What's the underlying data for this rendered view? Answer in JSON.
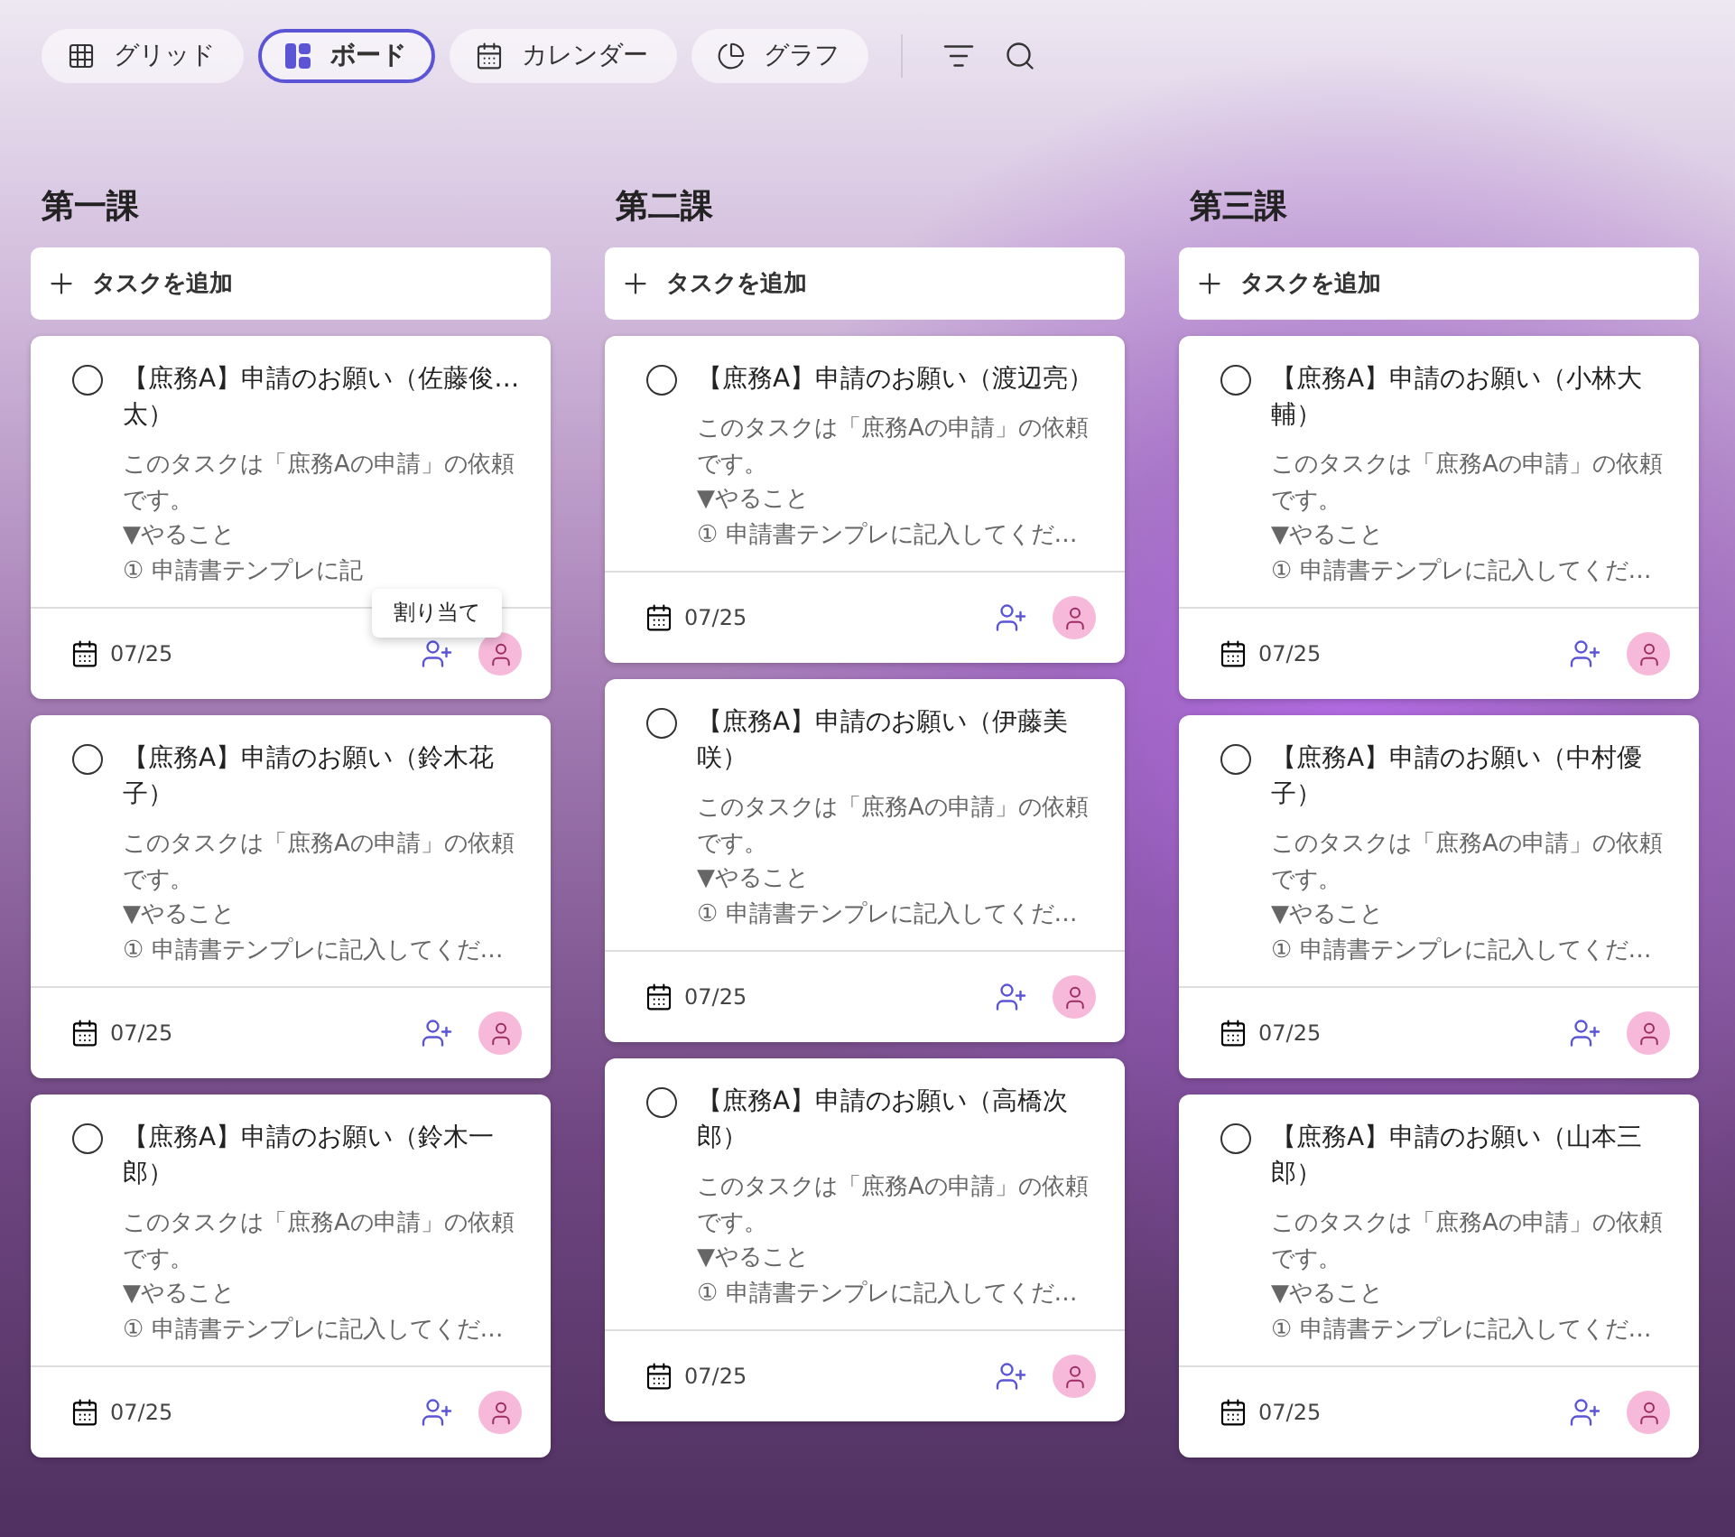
{
  "views": [
    {
      "kind": "grid",
      "label": "グリッド",
      "selected": false
    },
    {
      "kind": "board",
      "label": "ボード",
      "selected": true
    },
    {
      "kind": "calendar",
      "label": "カレンダー",
      "selected": false
    },
    {
      "kind": "chart",
      "label": "グラフ",
      "selected": false
    }
  ],
  "columns": [
    {
      "title": "第一課",
      "add_label": "タスクを追加",
      "cards": [
        {
          "checked": false,
          "title": "【庶務A】申請のお願い（佐藤俊…太）",
          "description": [
            "このタスクは「庶務Aの申請」の依頼です。",
            "▼やること",
            "① 申請書テンプレに記"
          ],
          "due": "07/25",
          "tooltip": "割り当て"
        },
        {
          "checked": false,
          "title": "【庶務A】申請のお願い（鈴木花子）",
          "description": [
            "このタスクは「庶務Aの申請」の依頼です。",
            "▼やること",
            "① 申請書テンプレに記入してくだ…"
          ],
          "due": "07/25"
        },
        {
          "checked": false,
          "title": "【庶務A】申請のお願い（鈴木一郎）",
          "description": [
            "このタスクは「庶務Aの申請」の依頼です。",
            "▼やること",
            "① 申請書テンプレに記入してくだ…"
          ],
          "due": "07/25"
        }
      ]
    },
    {
      "title": "第二課",
      "add_label": "タスクを追加",
      "cards": [
        {
          "checked": false,
          "title": "【庶務A】申請のお願い（渡辺亮）",
          "description": [
            "このタスクは「庶務Aの申請」の依頼です。",
            "▼やること",
            "① 申請書テンプレに記入してくだ…"
          ],
          "due": "07/25"
        },
        {
          "checked": false,
          "title": "【庶務A】申請のお願い（伊藤美咲）",
          "description": [
            "このタスクは「庶務Aの申請」の依頼です。",
            "▼やること",
            "① 申請書テンプレに記入してくだ…"
          ],
          "due": "07/25"
        },
        {
          "checked": false,
          "title": "【庶務A】申請のお願い（高橋次郎）",
          "description": [
            "このタスクは「庶務Aの申請」の依頼です。",
            "▼やること",
            "① 申請書テンプレに記入してくだ…"
          ],
          "due": "07/25"
        }
      ]
    },
    {
      "title": "第三課",
      "add_label": "タスクを追加",
      "cards": [
        {
          "checked": false,
          "title": "【庶務A】申請のお願い（小林大輔）",
          "description": [
            "このタスクは「庶務Aの申請」の依頼です。",
            "▼やること",
            "① 申請書テンプレに記入してくだ…"
          ],
          "due": "07/25"
        },
        {
          "checked": false,
          "title": "【庶務A】申請のお願い（中村優子）",
          "description": [
            "このタスクは「庶務Aの申請」の依頼です。",
            "▼やること",
            "① 申請書テンプレに記入してくだ…"
          ],
          "due": "07/25"
        },
        {
          "checked": false,
          "title": "【庶務A】申請のお願い（山本三郎）",
          "description": [
            "このタスクは「庶務Aの申請」の依頼です。",
            "▼やること",
            "① 申請書テンプレに記入してくだ…"
          ],
          "due": "07/25"
        }
      ]
    }
  ]
}
